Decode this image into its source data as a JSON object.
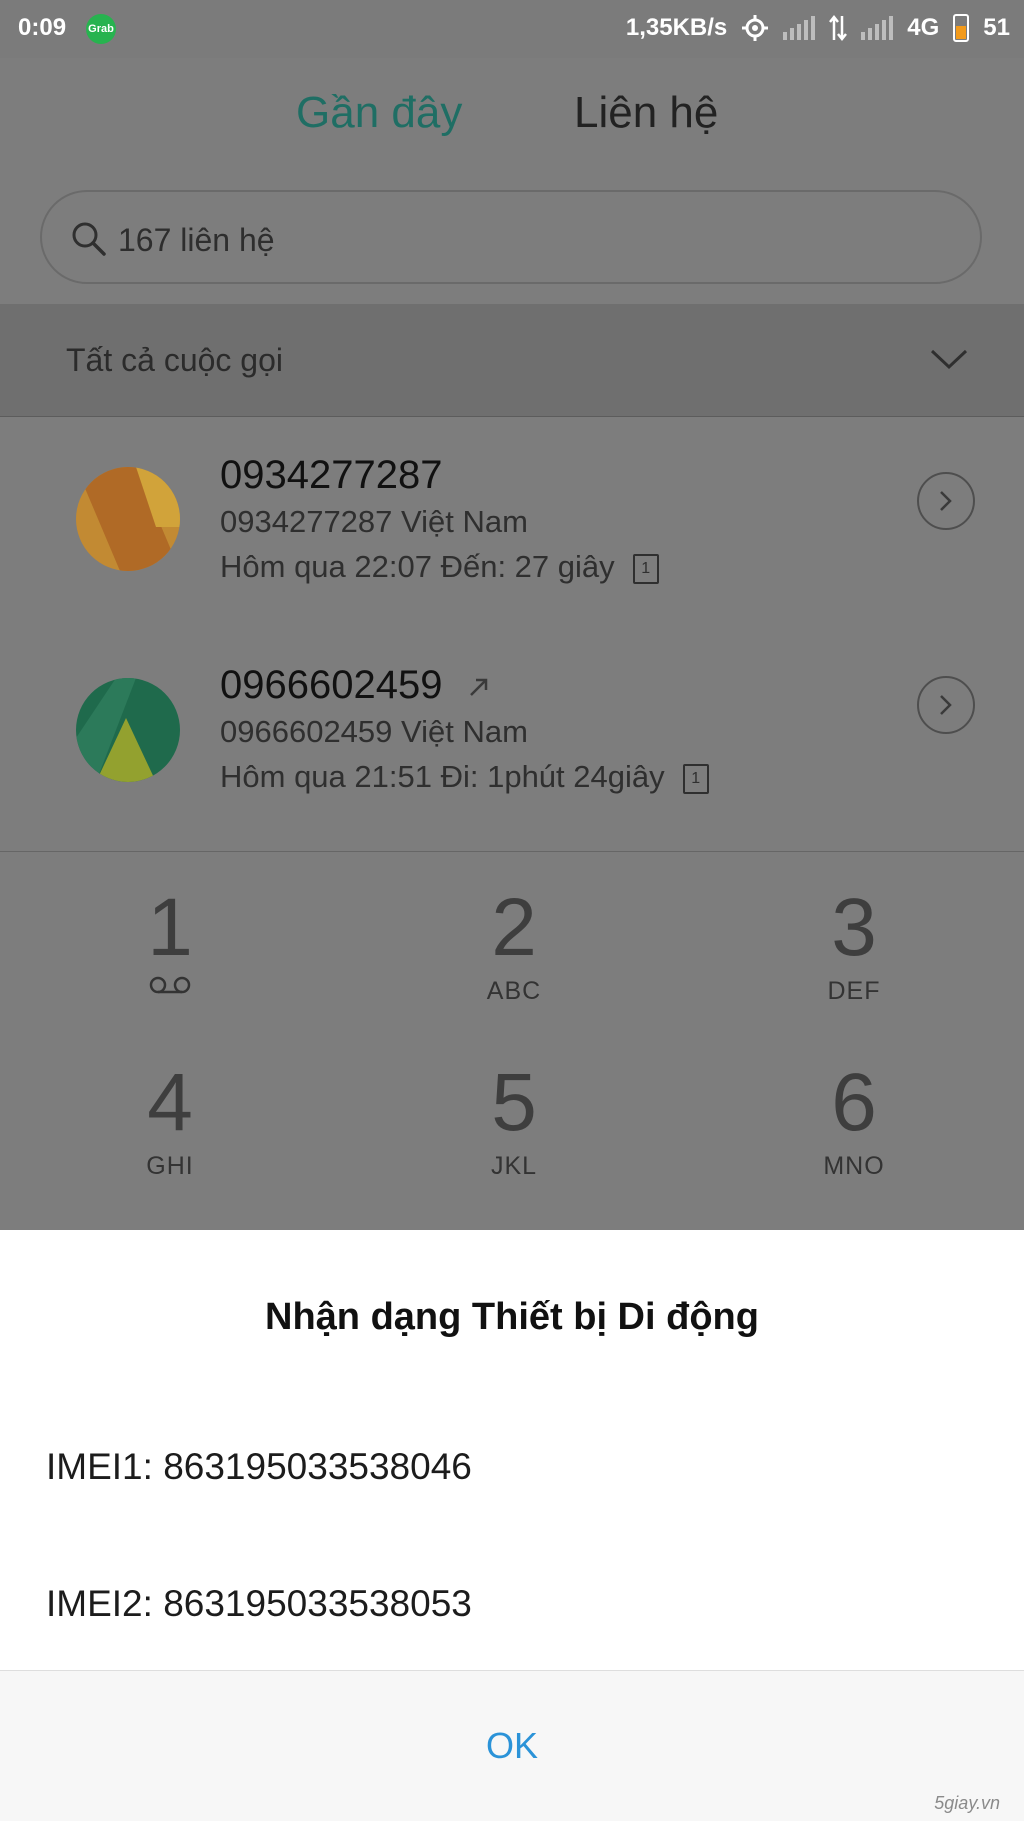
{
  "status_bar": {
    "time": "0:09",
    "app_icon": "grab-icon",
    "app_icon_text": "Grab",
    "speed": "1,35KB/s",
    "network": "4G",
    "battery": "51",
    "battery_level": 0.51
  },
  "tabs": [
    {
      "label": "Gần đây",
      "active": true
    },
    {
      "label": "Liên hệ",
      "active": false
    }
  ],
  "search": {
    "placeholder": "167 liên hệ",
    "value": ""
  },
  "filter": {
    "label": "Tất cả cuộc gọi"
  },
  "calls": [
    {
      "name": "0934277287",
      "number_line": "0934277287  Việt Nam",
      "detail_line": "Hôm qua 22:07 Đến: 27 giây",
      "sim": "1",
      "direction": "incoming",
      "avatar_colors": [
        "#c2732b",
        "#a5561f"
      ]
    },
    {
      "name": "0966602459",
      "number_line": "0966602459  Việt Nam",
      "detail_line": "Hôm qua 21:51 Đi: 1phút 24giây",
      "sim": "1",
      "direction": "outgoing",
      "avatar_colors": [
        "#23664a",
        "#8f9a2e"
      ]
    }
  ],
  "keypad": [
    {
      "digit": "1",
      "letters": "",
      "icon": "voicemail-icon"
    },
    {
      "digit": "2",
      "letters": "ABC"
    },
    {
      "digit": "3",
      "letters": "DEF"
    },
    {
      "digit": "4",
      "letters": "GHI"
    },
    {
      "digit": "5",
      "letters": "JKL"
    },
    {
      "digit": "6",
      "letters": "MNO"
    }
  ],
  "dialog": {
    "title": "Nhận dạng Thiết bị Di động",
    "imei1": "IMEI1: 863195033538046",
    "imei2": "IMEI2: 863195033538053",
    "ok_label": "OK"
  },
  "watermark": "5giay.vn",
  "colors": {
    "accent": "#1f6e64",
    "ok": "#2b93d8",
    "battery": "#f29a1b"
  }
}
